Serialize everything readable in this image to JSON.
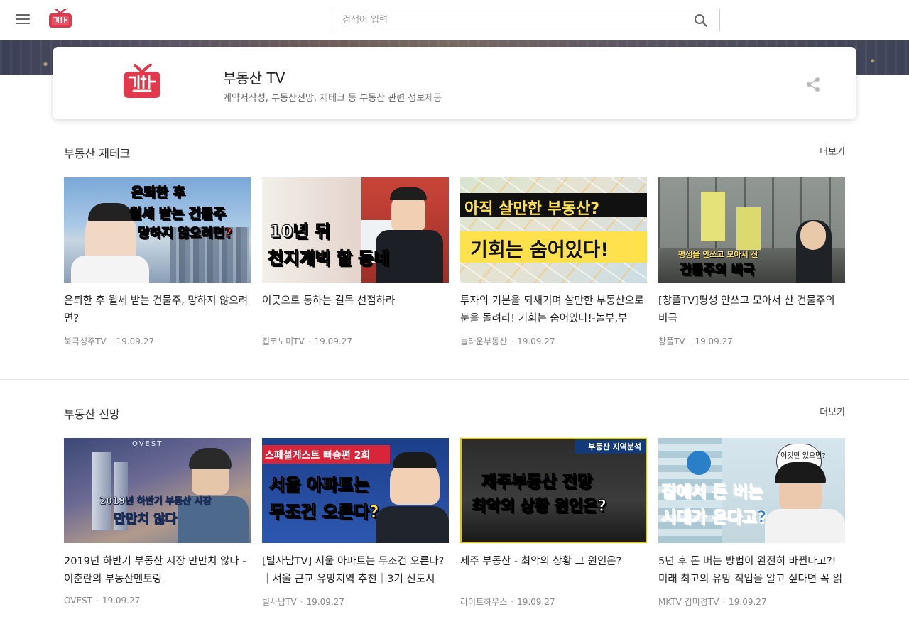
{
  "header": {
    "search_placeholder": "검색어 입력"
  },
  "channel": {
    "name": "부동산 TV",
    "description": "계약서작성, 부동산전망, 재테크 등 부동산 관련 정보제공"
  },
  "sections": [
    {
      "title": "부동산 재테크",
      "more_label": "더보기",
      "videos": [
        {
          "title": "은퇴한 후 월세 받는 건물주, 망하지 않으려면?",
          "channel": "북극성주TV",
          "date": "19.09.27",
          "thumb_text": [
            "은퇴한 후",
            "월세 받는 건물주",
            "망하지 않으려면?"
          ]
        },
        {
          "title": "이곳으로 통하는 길목 선점하라",
          "channel": "집코노미TV",
          "date": "19.09.27",
          "thumb_text": [
            "10년 뒤",
            "천지개벽 할 동네"
          ]
        },
        {
          "title": "투자의 기본을 되새기며 살만한 부동산으로 눈을 돌려라! 기회는 숨어있다!-놀부,부",
          "channel": "놀라운부동산",
          "date": "19.09.27",
          "thumb_text": [
            "아직 살만한 부동산?",
            "기회는 숨어있다!"
          ]
        },
        {
          "title": "[창플TV]평생 안쓰고 모아서 산 건물주의 비극",
          "channel": "창플TV",
          "date": "19.09.27",
          "thumb_text": [
            "평생을 안쓰고 모아서 산",
            "건물주의 비극"
          ]
        }
      ]
    },
    {
      "title": "부동산 전망",
      "more_label": "더보기",
      "videos": [
        {
          "title": "2019년 하반기 부동산 시장 만만치 않다 - 이춘란의 부동산멘토링",
          "channel": "OVEST",
          "date": "19.09.27",
          "thumb_text": [
            "OVEST",
            "2019년 하반기 부동산 시장",
            "만만치 않다"
          ]
        },
        {
          "title": "[빌사남TV] 서울 아파트는 무조건 오른다? ｜서울 근교 유망지역 추천｜3기 신도시",
          "channel": "빌사남TV",
          "date": "19.09.27",
          "thumb_text": [
            "스페셜게스트 빠숑편 2회",
            "서울 아파트는",
            "무조건 오른다?"
          ]
        },
        {
          "title": "제주 부동산 - 최악의 상황 그 원인은?",
          "channel": "라이트하우스",
          "date": "19.09.27",
          "thumb_text": [
            "부동산 지역분석",
            "제주부동산 전망",
            "최악의 상황 원인은?"
          ]
        },
        {
          "title": "5년 후 돈 버는 방법이 완전히 바뀐다고?! 미래 최고의 유망 직업을 알고 싶다면 꼭 읽",
          "channel": "MKTV 김미경TV",
          "date": "19.09.27",
          "thumb_text": [
            "이것만 있으면?",
            "집에서 돈 버는",
            "시대가 온다고?"
          ]
        }
      ]
    }
  ],
  "colors": {
    "brand_red": "#e0394e",
    "text_primary": "#222222",
    "text_meta": "#888888"
  }
}
